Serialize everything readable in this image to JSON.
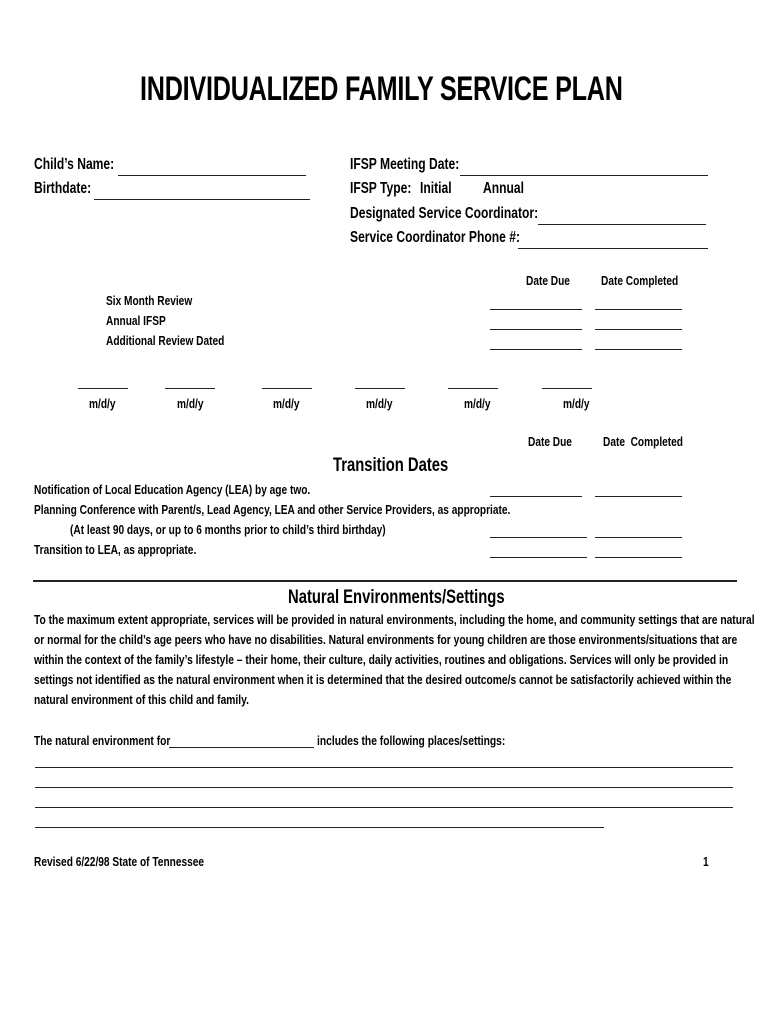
{
  "document": {
    "title": "INDIVIDUALIZED FAMILY SERVICE PLAN",
    "header_fields": {
      "child_name_label": "Child’s Name:",
      "child_name_value": "",
      "birthdate_label": "Birthdate:",
      "birthdate_value": "",
      "meeting_date_label": "IFSP Meeting Date:",
      "meeting_date_value": "",
      "ifsp_type_label": "IFSP Type:",
      "ifsp_type_options": [
        "Initial",
        "Annual"
      ],
      "coordinator_label": "Designated Service Coordinator:",
      "coordinator_value": "",
      "coordinator_phone_label": "Service Coordinator Phone #:",
      "coordinator_phone_value": ""
    },
    "reviews": {
      "col_headers": [
        "Date Due",
        "Date Completed"
      ],
      "rows": [
        {
          "label": "Six Month Review",
          "date_due": "",
          "date_completed": ""
        },
        {
          "label": "Annual IFSP",
          "date_due": "",
          "date_completed": ""
        },
        {
          "label": "Additional Review Dated",
          "date_due": "",
          "date_completed": ""
        }
      ]
    },
    "review_dates": {
      "format_label": "m/d/y",
      "count": 6
    },
    "transition": {
      "title": "Transition Dates",
      "col_headers": [
        "Date Due",
        "Date  Completed"
      ],
      "rows": [
        {
          "label": "Notification of Local Education Agency (LEA) by age two.",
          "date_due": "",
          "date_completed": ""
        },
        {
          "label": "Planning Conference with Parent/s, Lead Agency, LEA and other Service Providers, as appropriate.",
          "sublabel": "(At least 90 days, or up to 6 months prior to child’s third birthday)",
          "date_due": "",
          "date_completed": ""
        },
        {
          "label": "Transition to LEA, as appropriate.",
          "date_due": "",
          "date_completed": ""
        }
      ]
    },
    "natural_environments": {
      "title": "Natural Environments/Settings",
      "paragraph_lines": [
        "To the maximum extent appropriate, services will be provided in natural environments, including the home, and community settings that are natural",
        "or normal for the child’s age peers who have no disabilities.  Natural environments for young children are those environments/situations that are",
        "within the context of the family’s lifestyle – their home, their culture, daily activities, routines and obligations.  Services will only be provided in",
        "settings not identified as the natural environment when it is determined that the desired outcome/s cannot be satisfactorily achieved within the",
        "natural environment of this child and family."
      ],
      "sentence_prefix": "The natural environment for",
      "sentence_blank_value": "",
      "sentence_suffix": "includes the following places/settings:",
      "settings_lines": [
        "",
        "",
        "",
        ""
      ]
    },
    "footer": {
      "revision": "Revised 6/22/98 State of Tennessee",
      "page_number": "1"
    }
  }
}
